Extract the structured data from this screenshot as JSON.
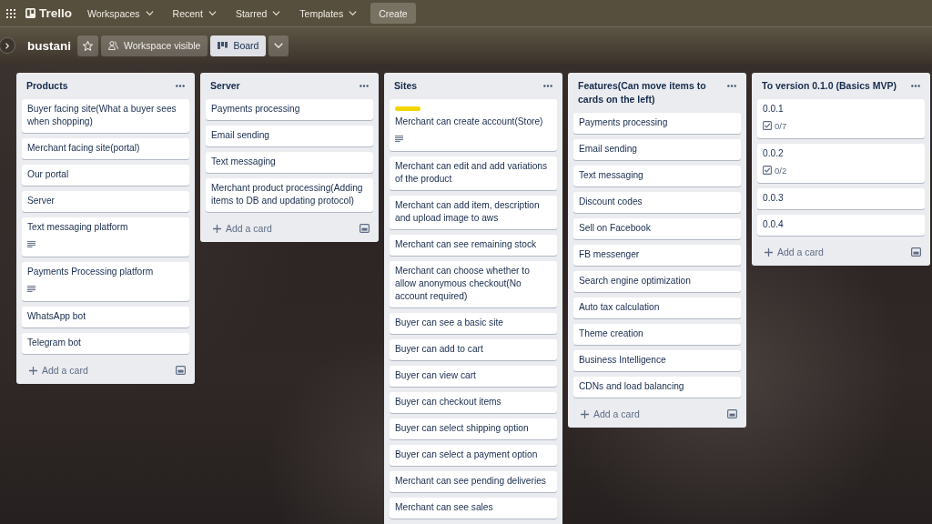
{
  "top_nav": {
    "logo": "Trello",
    "menus": [
      {
        "label": "Workspaces"
      },
      {
        "label": "Recent"
      },
      {
        "label": "Starred"
      },
      {
        "label": "Templates"
      }
    ],
    "create_button": "Create"
  },
  "board_header": {
    "board_name": "bustani",
    "starred": false,
    "visibility": "Workspace visible",
    "views": [
      {
        "label": "Board",
        "selected": true
      }
    ]
  },
  "lists": [
    {
      "title": "Products",
      "cards": [
        {
          "title": "Buyer facing site(What a buyer sees when shopping)",
          "description": false
        },
        {
          "title": "Merchant facing site(portal)",
          "description": false
        },
        {
          "title": "Our portal",
          "description": false
        },
        {
          "title": "Server",
          "description": false
        },
        {
          "title": "Text messaging platform",
          "description": true
        },
        {
          "title": "Payments Processing platform",
          "description": true
        },
        {
          "title": "WhatsApp bot",
          "description": false
        },
        {
          "title": "Telegram bot",
          "description": false
        }
      ],
      "add_card": "Add a card"
    },
    {
      "title": "Server",
      "cards": [
        {
          "title": "Payments processing",
          "description": false
        },
        {
          "title": "Email sending",
          "description": false
        },
        {
          "title": "Text messaging",
          "description": false
        },
        {
          "title": "Merchant product processing(Adding items to DB and updating protocol)",
          "description": false
        }
      ],
      "add_card": "Add a card"
    },
    {
      "title": "Sites",
      "cards": [
        {
          "title": "Merchant can create account(Store)",
          "description": true,
          "labels": [
            {
              "color": "#f2d600"
            }
          ]
        },
        {
          "title": "Merchant can edit and add variations of the product",
          "description": false
        },
        {
          "title": "Merchant can add item, description and upload image to aws",
          "description": false
        },
        {
          "title": "Merchant can see remaining stock",
          "description": false
        },
        {
          "title": "Merchant can choose whether to allow anonymous checkout(No account required)",
          "description": false
        },
        {
          "title": "Buyer can see a basic site",
          "description": false
        },
        {
          "title": "Buyer can add to cart",
          "description": false
        },
        {
          "title": "Buyer can view cart",
          "description": false
        },
        {
          "title": "Buyer can checkout items",
          "description": false
        },
        {
          "title": "Buyer can select shipping option",
          "description": false
        },
        {
          "title": "Buyer can select a payment option",
          "description": false
        },
        {
          "title": "Merchant can see pending deliveries",
          "description": false
        },
        {
          "title": "Merchant can see sales",
          "description": false
        }
      ]
    },
    {
      "title": "Features(Can move items to cards on the left)",
      "cards": [
        {
          "title": "Payments processing",
          "description": false
        },
        {
          "title": "Email sending",
          "description": false
        },
        {
          "title": "Text messaging",
          "description": false
        },
        {
          "title": "Discount codes",
          "description": false
        },
        {
          "title": "Sell on Facebook",
          "description": false
        },
        {
          "title": "FB messenger",
          "description": false
        },
        {
          "title": "Search engine optimization",
          "description": false
        },
        {
          "title": "Auto tax calculation",
          "description": false
        },
        {
          "title": "Theme creation",
          "description": false
        },
        {
          "title": "Business Intelligence",
          "description": false
        },
        {
          "title": "CDNs and load balancing",
          "description": false
        }
      ],
      "add_card": "Add a card"
    },
    {
      "title": "To version 0.1.0 (Basics MVP)",
      "cards": [
        {
          "title": "0.0.1",
          "description": false,
          "checklist": "0/7"
        },
        {
          "title": "0.0.2",
          "description": false,
          "checklist": "0/2"
        },
        {
          "title": "0.0.3",
          "description": false
        },
        {
          "title": "0.0.4",
          "description": false
        }
      ],
      "add_card": "Add a card"
    }
  ]
}
